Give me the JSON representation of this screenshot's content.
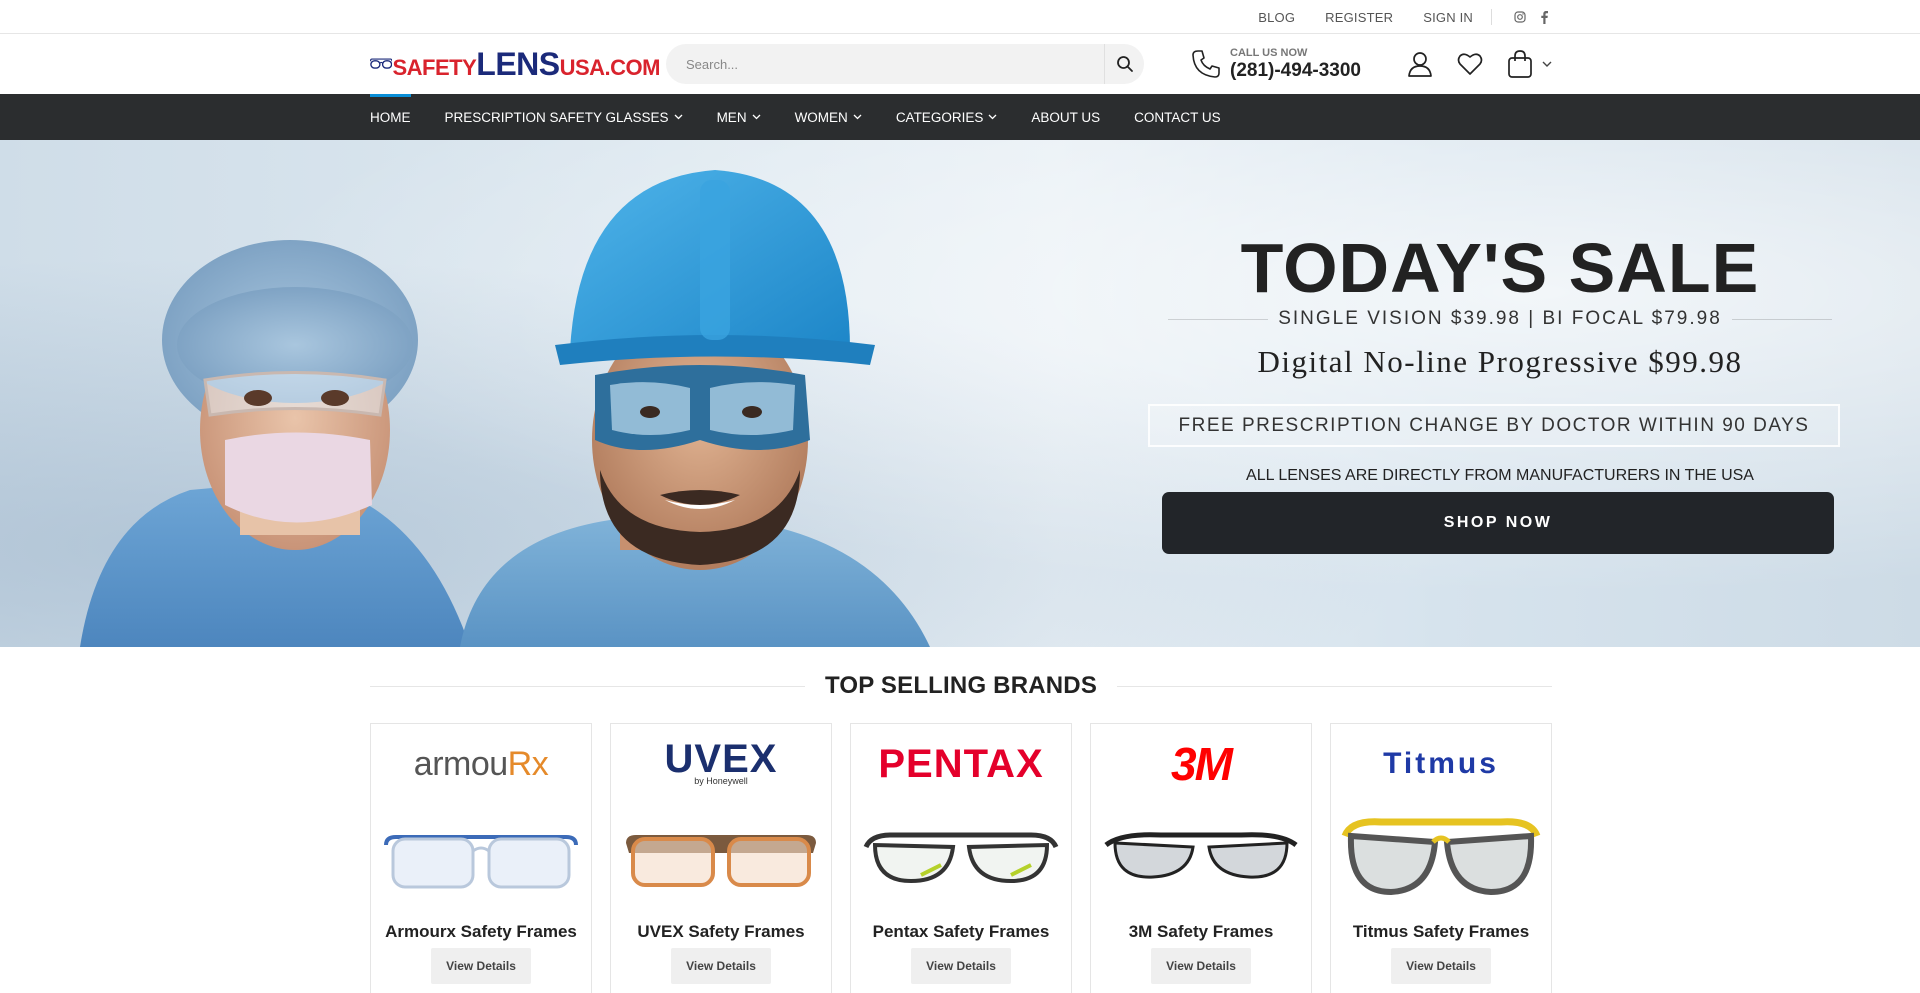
{
  "topbar": {
    "links": [
      "BLOG",
      "REGISTER",
      "SIGN IN"
    ],
    "social": [
      "instagram-icon",
      "facebook-icon"
    ]
  },
  "header": {
    "logo": {
      "part1": "SAFETY",
      "part2": "LENS",
      "part3": "USA.COM"
    },
    "search_placeholder": "Search...",
    "call_label": "CALL US NOW",
    "call_number": "(281)-494-3300"
  },
  "nav": {
    "items": [
      {
        "label": "HOME",
        "dropdown": false,
        "active": true
      },
      {
        "label": "PRESCRIPTION SAFETY GLASSES",
        "dropdown": true
      },
      {
        "label": "MEN",
        "dropdown": true
      },
      {
        "label": "WOMEN",
        "dropdown": true
      },
      {
        "label": "CATEGORIES",
        "dropdown": true
      },
      {
        "label": "ABOUT US",
        "dropdown": false
      },
      {
        "label": "CONTACT US",
        "dropdown": false
      }
    ]
  },
  "hero": {
    "title": "TODAY'S SALE",
    "subtitle": "SINGLE VISION $39.98 | BI FOCAL $79.98",
    "progressive": "Digital No-line Progressive $99.98",
    "free_change": "FREE PRESCRIPTION CHANGE BY DOCTOR WITHIN 90 DAYS",
    "lenses_note": "ALL LENSES ARE DIRECTLY FROM MANUFACTURERS IN THE USA",
    "cta": "SHOP NOW"
  },
  "brands": {
    "title": "TOP SELLING BRANDS",
    "cards": [
      {
        "logo": "armouRx",
        "name": "Armourx Safety Frames",
        "button": "View Details"
      },
      {
        "logo": "UVEX",
        "logo_sub": "by Honeywell",
        "name": "UVEX Safety Frames",
        "button": "View Details"
      },
      {
        "logo": "PENTAX",
        "name": "Pentax Safety Frames",
        "button": "View Details"
      },
      {
        "logo": "3M",
        "name": "3M Safety Frames",
        "button": "View Details"
      },
      {
        "logo": "TITMUS",
        "name": "Titmus Safety Frames",
        "button": "View Details"
      }
    ]
  },
  "colors": {
    "nav_bg": "#2b2d2f",
    "accent": "#0a8fd8",
    "logo_red": "#d9232d",
    "logo_blue": "#1b2a7a",
    "cta_bg": "#222529"
  }
}
